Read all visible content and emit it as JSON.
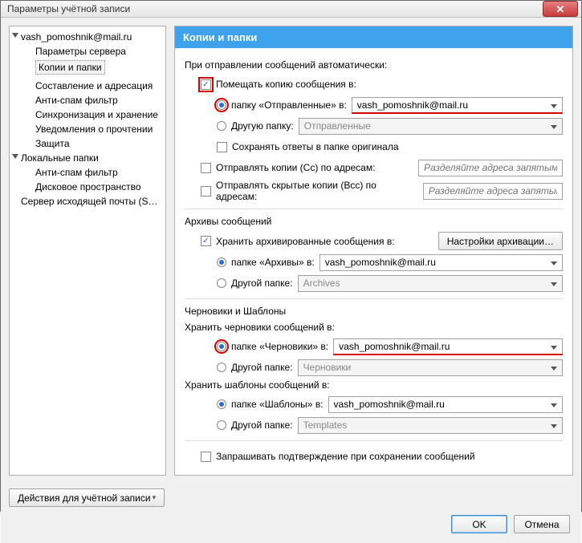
{
  "window": {
    "title": "Параметры учётной записи"
  },
  "tree": {
    "account": "vash_pomoshnik@mail.ru",
    "items": [
      "Параметры сервера",
      "Копии и папки",
      "Составление и адресация",
      "Анти-спам фильтр",
      "Синхронизация и хранение",
      "Уведомления о прочтении",
      "Защита"
    ],
    "local_header": "Локальные папки",
    "local_items": [
      "Анти-спам фильтр",
      "Дисковое пространство"
    ],
    "outgoing": "Сервер исходящей почты (S…"
  },
  "header": "Копии и папки",
  "sending": {
    "section": "При отправлении сообщений автоматически:",
    "place_copy": "Помещать копию сообщения в:",
    "sent_folder_label": "папку «Отправленные» в:",
    "sent_account": "vash_pomoshnik@mail.ru",
    "other_folder_label": "Другую папку:",
    "other_folder_value": "Отправленные",
    "save_replies": "Сохранять ответы в папке оригинала",
    "cc_label": "Отправлять копии (Сс) по адресам:",
    "bcc_label": "Отправлять скрытые копии (Bcc) по адресам:",
    "addr_placeholder": "Разделяйте адреса запятыми"
  },
  "archive": {
    "section": "Архивы сообщений",
    "keep": "Хранить архивированные сообщения в:",
    "settings_btn": "Настройки архивации…",
    "arch_folder_label": "папке «Архивы» в:",
    "arch_account": "vash_pomoshnik@mail.ru",
    "other_label": "Другой папке:",
    "other_value": "Archives"
  },
  "drafts": {
    "section": "Черновики и Шаблоны",
    "drafts_label": "Хранить черновики сообщений в:",
    "drafts_folder_label": "папке «Черновики» в:",
    "drafts_account": "vash_pomoshnik@mail.ru",
    "other_label": "Другой папке:",
    "drafts_other_value": "Черновики",
    "templates_label": "Хранить шаблоны сообщений в:",
    "templates_folder_label": "папке «Шаблоны» в:",
    "templates_account": "vash_pomoshnik@mail.ru",
    "templates_other_value": "Templates"
  },
  "confirm_save": "Запрашивать подтверждение при сохранении сообщений",
  "account_actions": "Действия для учётной записи",
  "buttons": {
    "ok": "OK",
    "cancel": "Отмена"
  }
}
